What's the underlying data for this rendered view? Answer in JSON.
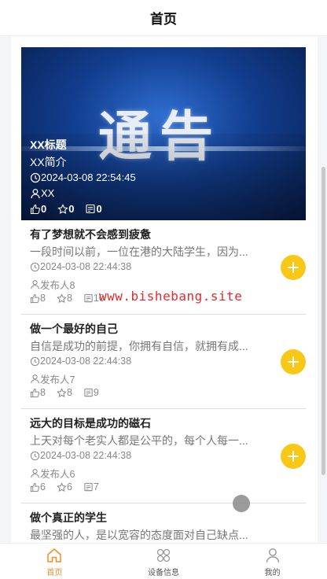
{
  "header": {
    "title": "首页"
  },
  "banner": {
    "big_text": "通告",
    "title": "XX标题",
    "intro": "XX简介",
    "time": "2024-03-08 22:54:45",
    "author": "XX",
    "likes": "0",
    "favorites": "0",
    "comments": "0"
  },
  "list": [
    {
      "title": "有了梦想就不会感到疲惫",
      "desc": "一段时间以前，一位在港的大陆学生，因为...",
      "time": "2024-03-08 22:44:38",
      "author": "发布人8",
      "likes": "8",
      "favorites": "8",
      "comments": "10"
    },
    {
      "title": "做一个最好的自己",
      "desc": "自信是成功的前提，你拥有自信，就拥有成...",
      "time": "2024-03-08 22:44:38",
      "author": "发布人7",
      "likes": "8",
      "favorites": "8",
      "comments": "9"
    },
    {
      "title": "远大的目标是成功的磁石",
      "desc": "上天对每个老实人都是公平的，每个人每一...",
      "time": "2024-03-08 22:44:38",
      "author": "发布人6",
      "likes": "6",
      "favorites": "6",
      "comments": "7"
    },
    {
      "title": "做个真正的学生",
      "desc": "最坚强的人，是以宽容的态度面对自己缺点..."
    }
  ],
  "watermark": "www.bishebang.site",
  "tabbar": {
    "items": [
      {
        "label": "首页",
        "icon": "home-icon",
        "active": true
      },
      {
        "label": "设备信息",
        "icon": "grid-icon",
        "active": false
      },
      {
        "label": "我的",
        "icon": "user-icon",
        "active": false
      }
    ]
  },
  "colors": {
    "accent": "#f7c818",
    "active_tab": "#f08a2a",
    "watermark": "#e8282a"
  }
}
